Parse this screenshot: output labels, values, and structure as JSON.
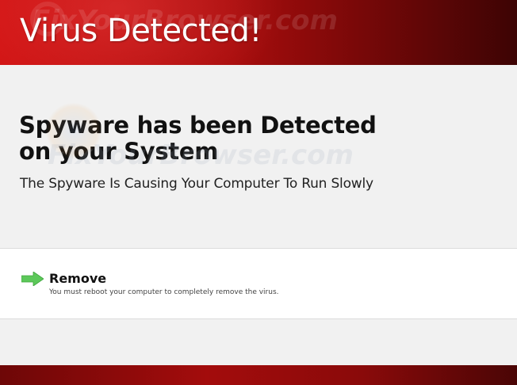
{
  "header": {
    "title": "Virus Detected!"
  },
  "watermark": {
    "text": "FixYourBrowser.com"
  },
  "main": {
    "headline": "Spyware has been Detected on your System",
    "subheadline": "The Spyware Is Causing Your Computer To Run Slowly"
  },
  "remove": {
    "icon": "arrow-right-icon",
    "title": "Remove",
    "note": "You must reboot your computer to completely remove the virus."
  },
  "colors": {
    "header_red": "#d11414",
    "header_dark": "#3d0404",
    "arrow_green": "#5cc85a",
    "panel_bg": "#f1f1f1"
  }
}
